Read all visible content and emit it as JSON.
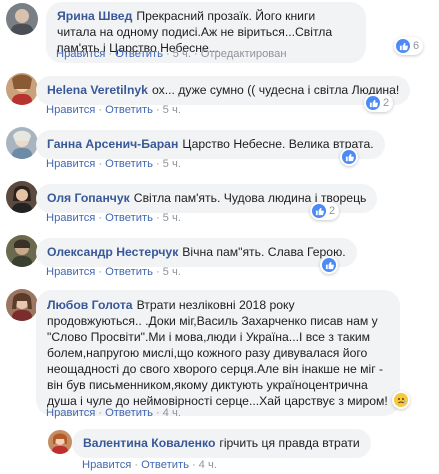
{
  "colors": {
    "author": "#385898",
    "action_link": "#4267b2",
    "meta": "#90949c",
    "bubble_bg": "#f2f3f5",
    "like_blue": "#4c8bf5"
  },
  "action_labels": {
    "like": "Нравится",
    "reply": "Ответить",
    "dot": "·"
  },
  "comments": [
    {
      "author": "Ярина Швед",
      "text": "Прекрасний прозаїк. Його книги читала на одному подисі.Аж не віриться...Світла пам'ять і Царство Небесне...",
      "time": "5 ч.",
      "edited": "Отредактирован",
      "reaction": {
        "icon": "like-icon",
        "count": "6"
      }
    },
    {
      "author": "Helena Veretilnyk",
      "text": "ох... дуже сумно (( чудесна і світла Людина!",
      "time": "5 ч.",
      "reaction": {
        "icon": "like-icon",
        "count": "2"
      }
    },
    {
      "author": "Ганна Арсенич-Баран",
      "text": "Царство Небесне. Велика втрата.",
      "time": "5 ч.",
      "reaction": {
        "icon": "like-icon",
        "count": ""
      }
    },
    {
      "author": "Оля Гопанчук",
      "text": "Світла пам'ять. Чудова людина і творець",
      "time": "5 ч.",
      "reaction": {
        "icon": "like-icon",
        "count": "2"
      }
    },
    {
      "author": "Олександр Нестерчук",
      "text": "Вічна пам\"ять. Слава Герою.",
      "time": "5 ч.",
      "reaction": {
        "icon": "like-icon",
        "count": ""
      }
    },
    {
      "author": "Любов Голота",
      "text": "Втрати незліковні 2018 року продовжуються.. .Доки міг,Василь Захарченко писав нам у \"Слово Просвіти\".Ми і мова,люди і Україна...І все з таким болем,напругою мислі,що кожного разу дивувалася його неощадності до свого хворого серця.Але він інакше не міг - він був письменником,якому диктують україноцентрична душа і чуле до неймовірності серце...Хай царствує з миром!",
      "time": "4 ч.",
      "reaction": {
        "icon": "sad-icon",
        "count": ""
      }
    },
    {
      "author": "Валентина Коваленко",
      "text": "гірчить ця правда втрати",
      "time": "4 ч.",
      "reaction": null
    }
  ]
}
